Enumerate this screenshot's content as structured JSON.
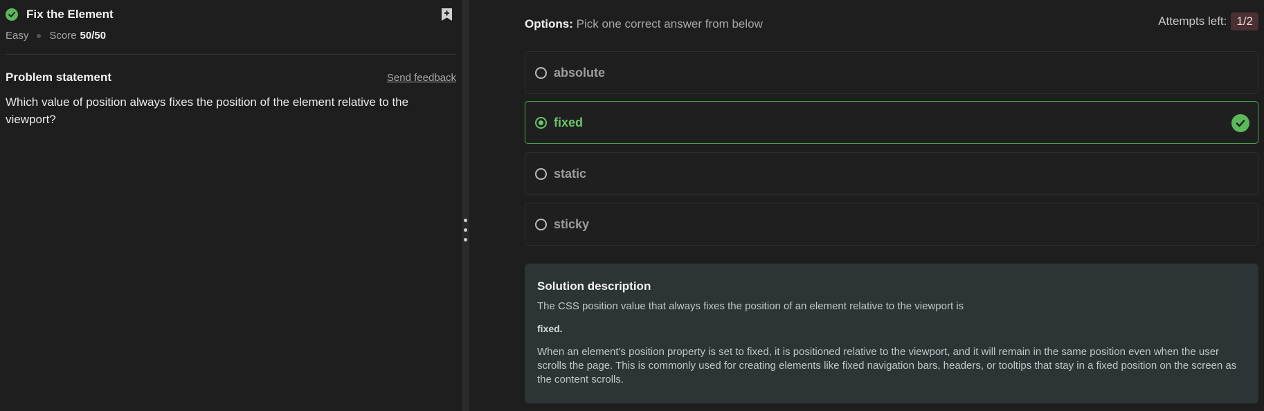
{
  "problem": {
    "title": "Fix the Element",
    "difficulty": "Easy",
    "score_label": "Score",
    "score_value": "50/50",
    "statement_title": "Problem statement",
    "feedback_link": "Send feedback",
    "statement_text": "Which value of position always fixes the position of the element relative to the viewport?"
  },
  "quiz": {
    "options_label": "Options:",
    "options_hint": "Pick one correct answer from below",
    "attempts_label": "Attempts left:",
    "attempts_value": "1/2",
    "options": [
      {
        "label": "absolute",
        "selected": false
      },
      {
        "label": "fixed",
        "selected": true,
        "correct": true
      },
      {
        "label": "static",
        "selected": false
      },
      {
        "label": "sticky",
        "selected": false
      }
    ]
  },
  "solution": {
    "title": "Solution description",
    "para1": "The CSS position value that always fixes the position of an element relative to the viewport is",
    "bold_answer": "fixed.",
    "para2": "When an element's position property is set to fixed, it is positioned relative to the viewport, and it will remain in the same position even when the user scrolls the page. This is commonly used for creating elements like fixed navigation bars, headers, or tooltips that stay in a fixed position on the screen as the content scrolls."
  },
  "colors": {
    "success": "#5cb85c",
    "selected_text": "#6ac46a",
    "solution_bg": "#2c3436",
    "attempts_badge_bg": "#4a2f33"
  },
  "icons": {
    "solved": "check-circle-icon",
    "bookmark": "bookmark-plus-icon",
    "splitter": "vertical-dots-icon",
    "correct": "check-circle-icon"
  }
}
